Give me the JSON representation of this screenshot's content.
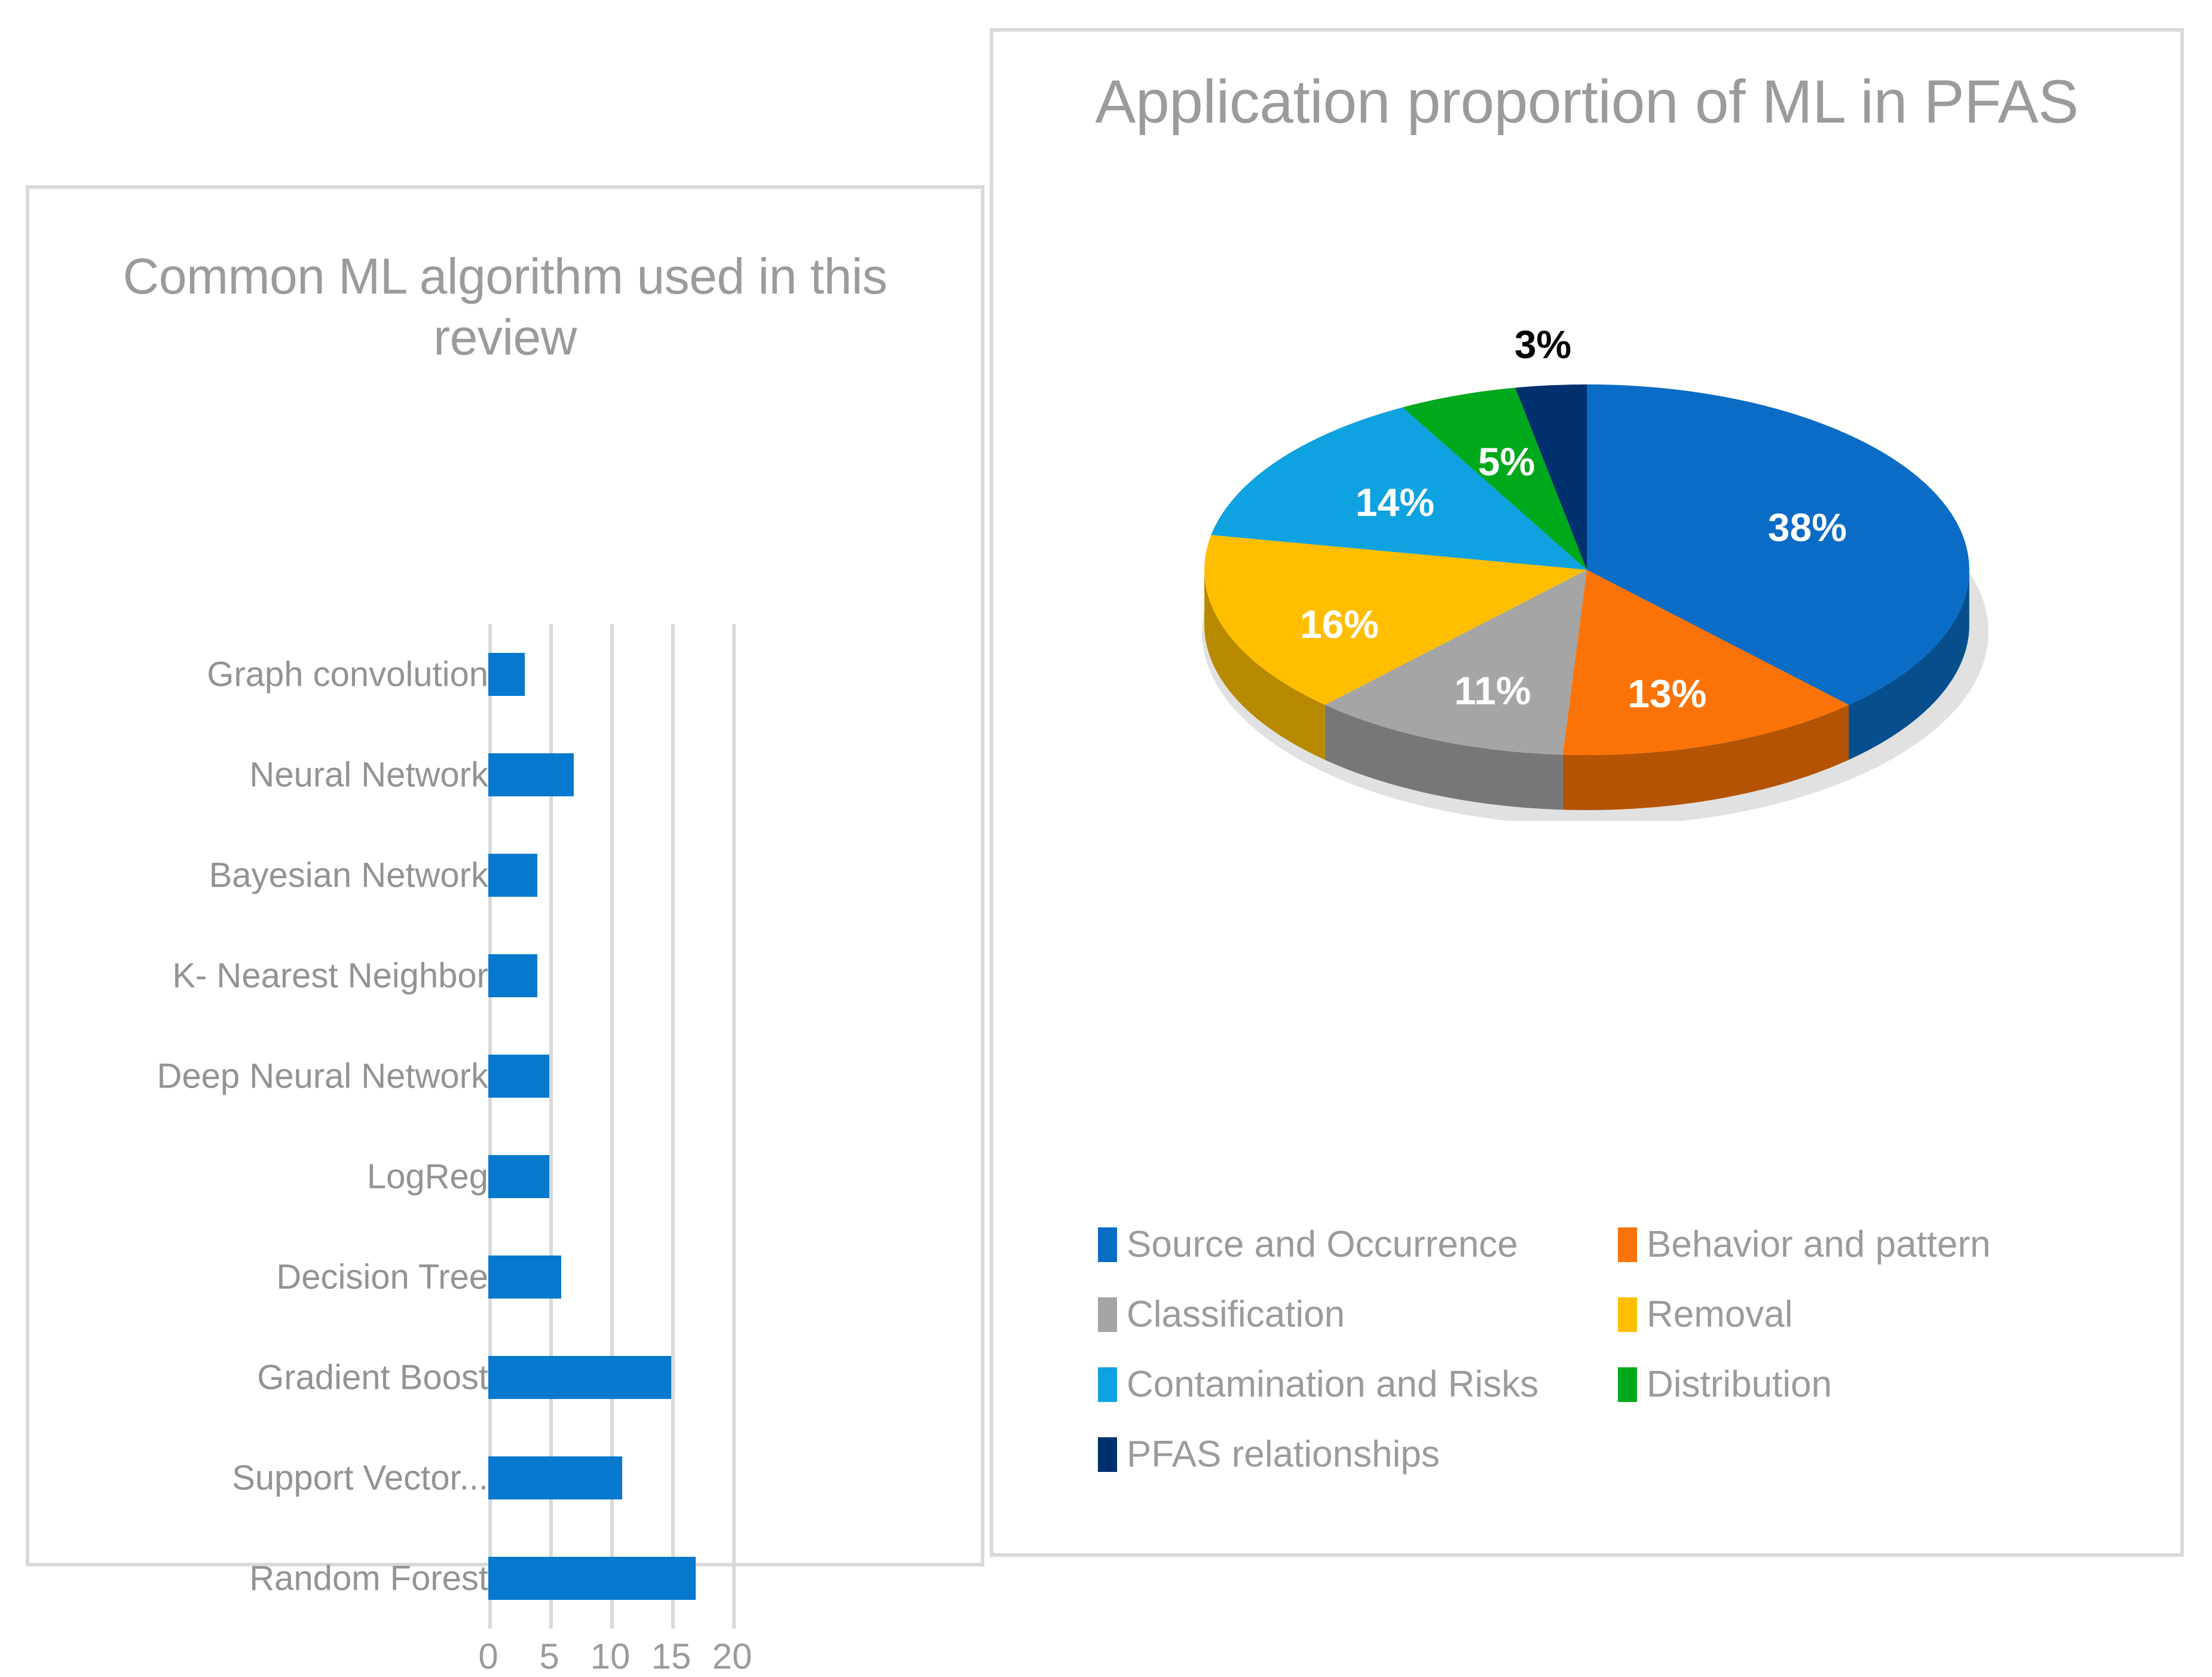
{
  "bar_panel": {
    "title": "Common ML algorithm used in this review"
  },
  "pie_panel": {
    "title": "Application proportion of ML in PFAS"
  },
  "chart_data": [
    {
      "type": "bar",
      "orientation": "horizontal",
      "title": "Common ML algorithm used in this review",
      "xlabel": "",
      "ylabel": "",
      "xlim": [
        0,
        20
      ],
      "xticks": [
        "0",
        "5",
        "10",
        "15",
        "20"
      ],
      "grid": true,
      "bar_color": "#0679ce",
      "categories": [
        "Graph convolution",
        "Neural Network",
        "Bayesian  Network",
        "K- Nearest Neighbor",
        "Deep Neural Network",
        "LogReg",
        "Decision Tree",
        "Gradient Boost",
        "Support Vector...",
        "Random Forest"
      ],
      "values": [
        3,
        7,
        4,
        4,
        5,
        5,
        6,
        15,
        11,
        17
      ]
    },
    {
      "type": "pie",
      "title": "Application proportion of ML in PFAS",
      "legend_position": "bottom",
      "labels": [
        "Source and Occurrence",
        "Behavior and pattern",
        "Classification",
        "Removal",
        "Contamination and Risks",
        "Distribution",
        "PFAS relationships"
      ],
      "values": [
        38,
        13,
        11,
        16,
        14,
        5,
        3
      ],
      "data_labels": [
        "38%",
        "13%",
        "11%",
        "16%",
        "14%",
        "5%",
        "3%"
      ],
      "colors": [
        "#0a6cc4",
        "#fb7307",
        "#a5a5a5",
        "#ffbf00",
        "#0ea2e0",
        "#00a81c",
        "#00306e"
      ],
      "label_text_colors": [
        "#ffffff",
        "#ffffff",
        "#ffffff",
        "#ffffff",
        "#ffffff",
        "#ffffff",
        "#000000"
      ]
    }
  ]
}
